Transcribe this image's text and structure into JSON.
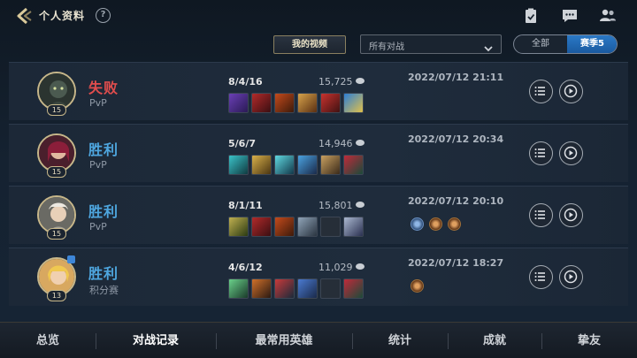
{
  "header": {
    "title": "个人资料",
    "help_icon": "?",
    "icons": [
      "back-icon",
      "clipboard-icon",
      "chat-icon",
      "friends-icon"
    ]
  },
  "filters": {
    "my_videos_label": "我的视频",
    "match_filter_value": "所有对战",
    "scope_options": [
      "全部",
      "赛季5"
    ],
    "scope_selected": "赛季5"
  },
  "matches": [
    {
      "result": "失败",
      "mode": "PvP",
      "level": "15",
      "kda": "8/4/16",
      "gold": "15,725",
      "date": "2022/07/12 21:11",
      "items": [
        "item-1",
        "item-2",
        "item-3",
        "item-4",
        "item-5",
        "item-6"
      ],
      "badges": []
    },
    {
      "result": "胜利",
      "mode": "PvP",
      "level": "15",
      "kda": "5/6/7",
      "gold": "14,946",
      "date": "2022/07/12 20:34",
      "items": [
        "item-1",
        "item-2",
        "item-3",
        "item-4",
        "item-5",
        "item-6"
      ],
      "badges": []
    },
    {
      "result": "胜利",
      "mode": "PvP",
      "level": "15",
      "kda": "8/1/11",
      "gold": "15,801",
      "date": "2022/07/12 20:10",
      "items": [
        "item-1",
        "item-2",
        "item-3",
        "item-4",
        "empty",
        "item-6"
      ],
      "badges": [
        "badge-blue",
        "badge-bronze",
        "badge-bronze"
      ]
    },
    {
      "result": "胜利",
      "mode": "积分赛",
      "level": "13",
      "kda": "4/6/12",
      "gold": "11,029",
      "date": "2022/07/12 18:27",
      "items": [
        "item-1",
        "item-2",
        "item-3",
        "item-4",
        "empty",
        "item-6"
      ],
      "badges": [
        "badge-bronze"
      ]
    }
  ],
  "colors": {
    "lose": "#e14d4d",
    "win": "#4ea6df",
    "accent_gold": "#c7b78a",
    "season_blue": "#2b79c6"
  },
  "bottom_nav": {
    "items": [
      "总览",
      "对战记录",
      "最常用英雄",
      "统计",
      "成就",
      "挚友"
    ],
    "active": "对战记录"
  }
}
